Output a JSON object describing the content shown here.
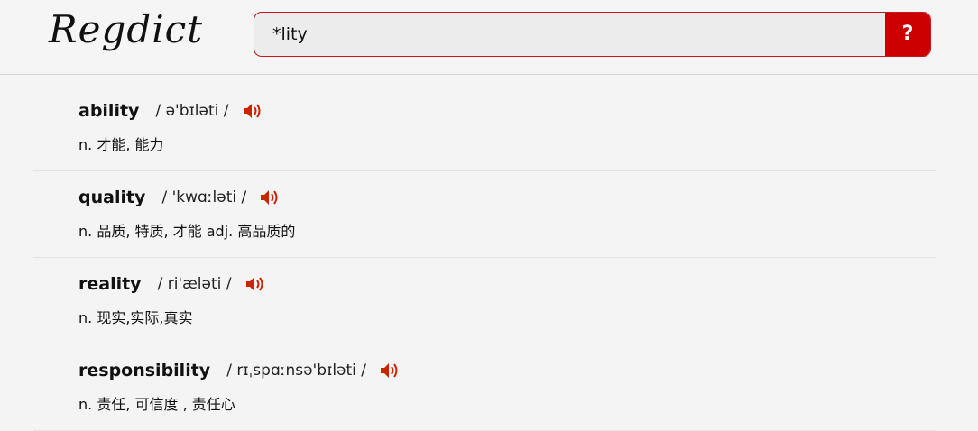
{
  "header": {
    "logo_text": "Regdict",
    "search": {
      "value": "*lity",
      "button_label": "?"
    }
  },
  "results": [
    {
      "word": "ability",
      "phonetic": "/ ə'bɪləti /",
      "definition": "n. 才能, 能力",
      "audio_icon": "speaker-icon"
    },
    {
      "word": "quality",
      "phonetic": "/ 'kwɑːləti /",
      "definition": "n. 品质, 特质, 才能 adj. 高品质的",
      "audio_icon": "speaker-icon"
    },
    {
      "word": "reality",
      "phonetic": "/ ri'æləti /",
      "definition": "n. 现实,实际,真实",
      "audio_icon": "speaker-icon"
    },
    {
      "word": "responsibility",
      "phonetic": "/ rɪˌspɑːnsə'bɪləti /",
      "definition": "n. 责任, 可信度 , 责任心",
      "audio_icon": "speaker-icon"
    }
  ],
  "colors": {
    "accent": "#cc0000",
    "speaker": "#cc2200"
  }
}
